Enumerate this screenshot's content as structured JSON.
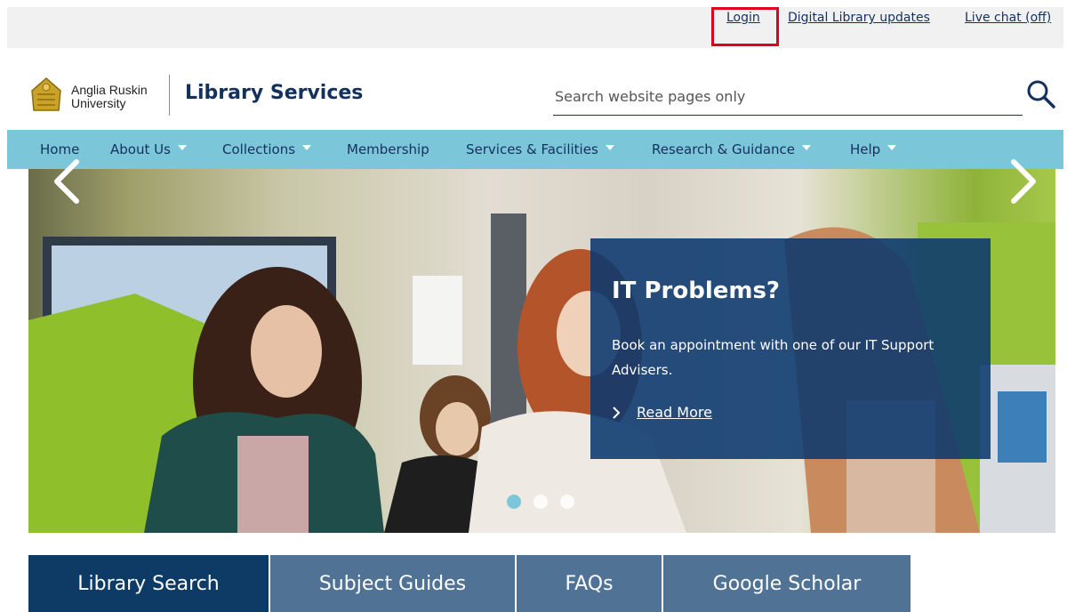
{
  "utility": {
    "links": [
      "Login",
      "Digital Library updates",
      "Live chat (off)"
    ]
  },
  "header": {
    "logo_line1": "Anglia Ruskin",
    "logo_line2": "University",
    "site_title": "Library Services",
    "search_placeholder": "Search website pages only"
  },
  "nav": {
    "items": [
      {
        "label": "Home",
        "has_dropdown": false
      },
      {
        "label": "About Us",
        "has_dropdown": true
      },
      {
        "label": "Collections",
        "has_dropdown": true
      },
      {
        "label": "Membership",
        "has_dropdown": false
      },
      {
        "label": "Services & Facilities",
        "has_dropdown": true
      },
      {
        "label": "Research & Guidance",
        "has_dropdown": true
      },
      {
        "label": "Help",
        "has_dropdown": true
      }
    ]
  },
  "hero": {
    "promo_title": "IT Problems?",
    "promo_text": "Book an appointment with one of our IT Support Advisers.",
    "promo_link": "Read More",
    "slides_total": 3,
    "active_slide": 1,
    "prev_icon": "chevron-left-icon",
    "next_icon": "chevron-right-icon"
  },
  "tabs": {
    "items": [
      {
        "label": "Library Search",
        "active": true
      },
      {
        "label": "Subject Guides",
        "active": false
      },
      {
        "label": "FAQs",
        "active": false
      },
      {
        "label": "Google Scholar",
        "active": false
      }
    ]
  },
  "colors": {
    "brand_navy": "#14315e",
    "nav_bg": "#7cc6d9",
    "tab_active": "#0d3b66",
    "tab_inactive": "#4f7295",
    "highlight_red": "#e0001b"
  }
}
